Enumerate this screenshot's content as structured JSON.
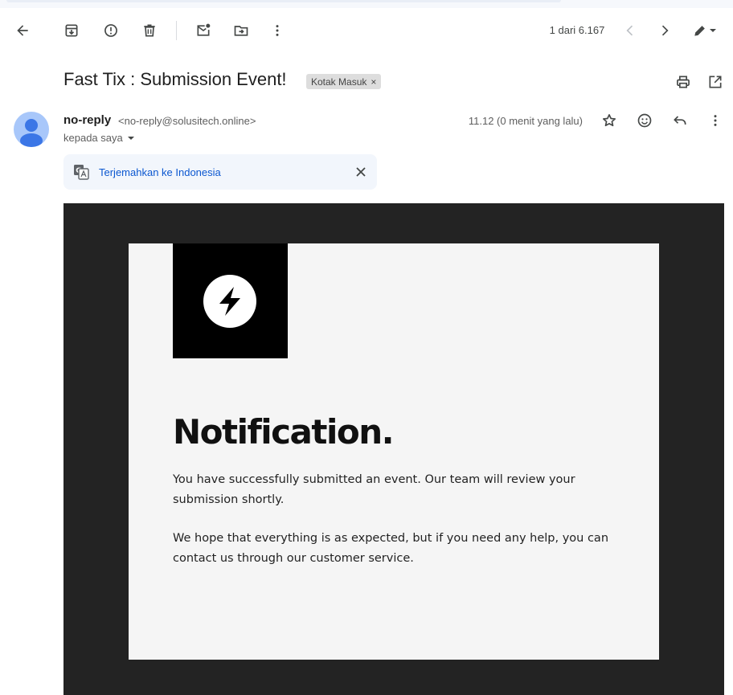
{
  "toolbar": {
    "icons": [
      "back-arrow-icon",
      "archive-icon",
      "report-spam-icon",
      "delete-icon",
      "mark-unread-icon",
      "move-to-icon",
      "more-vert-icon",
      "chevron-left-icon",
      "chevron-right-icon",
      "pen-icon",
      "dropdown-icon"
    ],
    "counter": "1 dari 6.167"
  },
  "message": {
    "subject": "Fast Tix : Submission Event!",
    "label": "Kotak Masuk",
    "label_close": "×",
    "sender_name": "no-reply",
    "sender_email": "<no-reply@solusitech.online>",
    "recipient": "kepada saya",
    "timestamp": "11.12 (0 menit yang lalu)"
  },
  "translate": {
    "link": "Terjemahkan ke Indonesia"
  },
  "email": {
    "heading": "Notification.",
    "paragraph1": "You have successfully submitted an event. Our team will review your submission shortly.",
    "paragraph2": "We hope that everything is as expected, but if you need any help, you can contact us through our customer service."
  },
  "colors": {
    "link": "#0b57d0",
    "email_background": "#232323",
    "card_background": "#f5f5f5",
    "logo_background": "#000000"
  }
}
